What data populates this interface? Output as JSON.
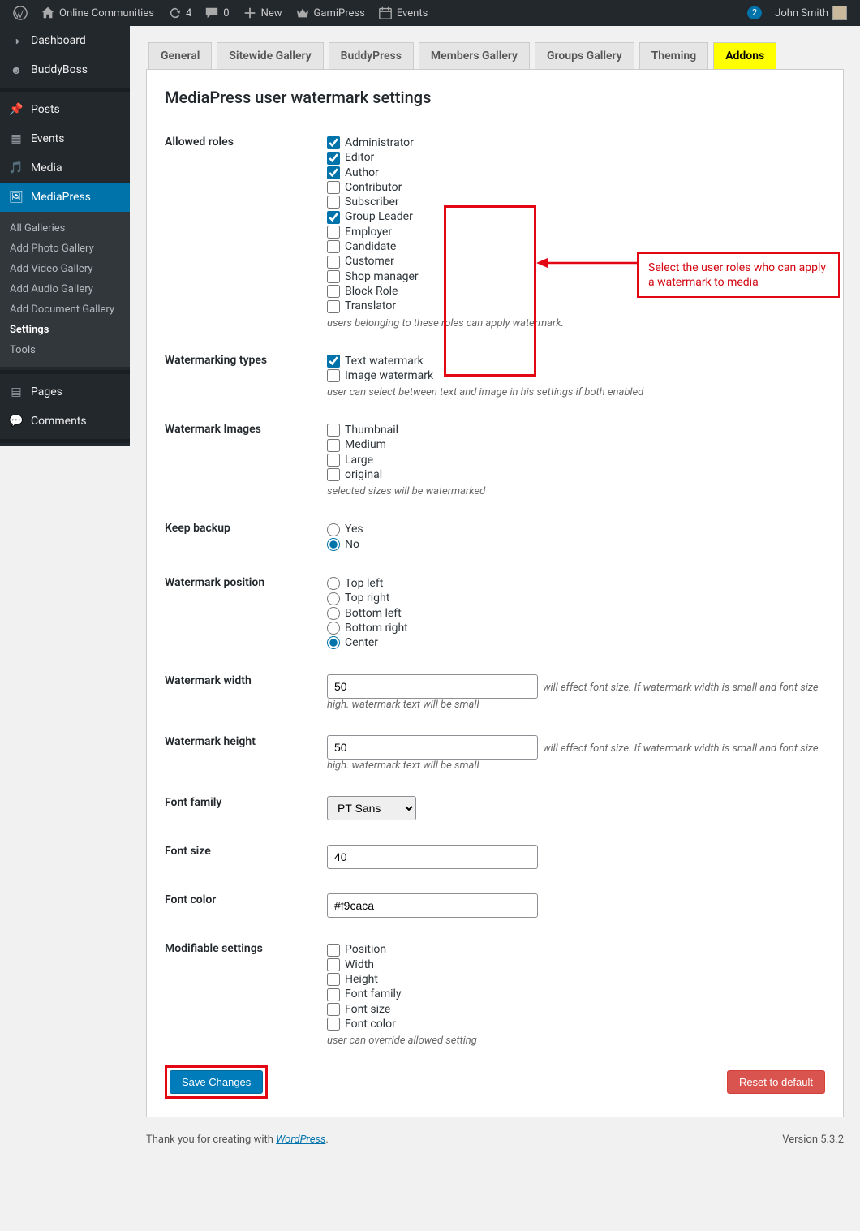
{
  "adminbar": {
    "site_name": "Online Communities",
    "updates": "4",
    "comments": "0",
    "new": "New",
    "gamipress": "GamiPress",
    "events": "Events",
    "user_notif": "2",
    "user_name": "John Smith"
  },
  "sidebar": {
    "dashboard": "Dashboard",
    "buddyboss": "BuddyBoss",
    "posts": "Posts",
    "events": "Events",
    "media": "Media",
    "mediapress": "MediaPress",
    "submenu": {
      "all": "All Galleries",
      "photo": "Add Photo Gallery",
      "video": "Add Video Gallery",
      "audio": "Add Audio Gallery",
      "doc": "Add Document Gallery",
      "settings": "Settings",
      "tools": "Tools"
    },
    "pages": "Pages",
    "comments": "Comments"
  },
  "tabs": {
    "general": "General",
    "sitewide": "Sitewide Gallery",
    "buddypress": "BuddyPress",
    "members": "Members Gallery",
    "groups": "Groups Gallery",
    "theming": "Theming",
    "addons": "Addons"
  },
  "page_title": "MediaPress user watermark settings",
  "annotation": "Select the user roles who can apply a watermark to media",
  "rows": {
    "allowed_roles": {
      "label": "Allowed roles",
      "options": [
        {
          "label": "Administrator",
          "checked": true
        },
        {
          "label": "Editor",
          "checked": true
        },
        {
          "label": "Author",
          "checked": true
        },
        {
          "label": "Contributor",
          "checked": false
        },
        {
          "label": "Subscriber",
          "checked": false
        },
        {
          "label": "Group Leader",
          "checked": true
        },
        {
          "label": "Employer",
          "checked": false
        },
        {
          "label": "Candidate",
          "checked": false
        },
        {
          "label": "Customer",
          "checked": false
        },
        {
          "label": "Shop manager",
          "checked": false
        },
        {
          "label": "Block Role",
          "checked": false
        },
        {
          "label": "Translator",
          "checked": false
        }
      ],
      "desc": "users belonging to these roles can apply watermark."
    },
    "watermarking_types": {
      "label": "Watermarking types",
      "options": [
        {
          "label": "Text watermark",
          "checked": true
        },
        {
          "label": "Image watermark",
          "checked": false
        }
      ],
      "desc": "user can select between text and image in his settings if both enabled"
    },
    "watermark_images": {
      "label": "Watermark Images",
      "options": [
        {
          "label": "Thumbnail",
          "checked": false
        },
        {
          "label": "Medium",
          "checked": false
        },
        {
          "label": "Large",
          "checked": false
        },
        {
          "label": "original",
          "checked": false
        }
      ],
      "desc": "selected sizes will be watermarked"
    },
    "keep_backup": {
      "label": "Keep backup",
      "options": [
        {
          "label": "Yes",
          "checked": false
        },
        {
          "label": "No",
          "checked": true
        }
      ]
    },
    "watermark_position": {
      "label": "Watermark position",
      "options": [
        {
          "label": "Top left",
          "checked": false
        },
        {
          "label": "Top right",
          "checked": false
        },
        {
          "label": "Bottom left",
          "checked": false
        },
        {
          "label": "Bottom right",
          "checked": false
        },
        {
          "label": "Center",
          "checked": true
        }
      ]
    },
    "watermark_width": {
      "label": "Watermark width",
      "value": "50",
      "note": "will effect font size. If watermark width is small and font size high. watermark text will be small"
    },
    "watermark_height": {
      "label": "Watermark height",
      "value": "50",
      "note": "will effect font size. If watermark width is small and font size high. watermark text will be small"
    },
    "font_family": {
      "label": "Font family",
      "value": "PT Sans"
    },
    "font_size": {
      "label": "Font size",
      "value": "40"
    },
    "font_color": {
      "label": "Font color",
      "value": "#f9caca"
    },
    "modifiable": {
      "label": "Modifiable settings",
      "options": [
        {
          "label": "Position",
          "checked": false
        },
        {
          "label": "Width",
          "checked": false
        },
        {
          "label": "Height",
          "checked": false
        },
        {
          "label": "Font family",
          "checked": false
        },
        {
          "label": "Font size",
          "checked": false
        },
        {
          "label": "Font color",
          "checked": false
        }
      ],
      "desc": "user can override allowed setting"
    }
  },
  "buttons": {
    "save": "Save Changes",
    "reset": "Reset to default"
  },
  "footer": {
    "thank": "Thank you for creating with ",
    "wp": "WordPress",
    "version": "Version 5.3.2"
  }
}
